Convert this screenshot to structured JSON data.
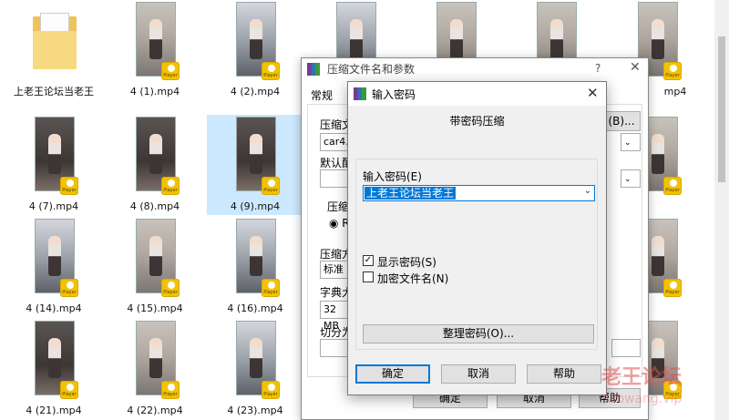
{
  "explorer": {
    "folder_label": "上老王论坛当老王",
    "files": [
      {
        "name": "4 (1).mp4"
      },
      {
        "name": "4 (2).mp4"
      },
      {
        "name": ""
      },
      {
        "name": ""
      },
      {
        "name": ""
      },
      {
        "name": "4"
      },
      {
        "name": "4 (7).mp4"
      },
      {
        "name": "4 (8).mp4"
      },
      {
        "name": "4 (9).mp4"
      },
      {
        "name": "4 (14).mp4"
      },
      {
        "name": "4 (15).mp4"
      },
      {
        "name": "4 (16).mp4"
      },
      {
        "name": "4 (21).mp4"
      },
      {
        "name": "4 (22).mp4"
      },
      {
        "name": "4 (23).mp4"
      }
    ],
    "right_col": [
      "mp4"
    ],
    "badge_label": "Player"
  },
  "back_dialog": {
    "title": "压缩文件名和参数",
    "help_glyph": "?",
    "close_glyph": "✕",
    "tab_general": "常规",
    "labels": [
      "压缩文",
      "默认配",
      "压缩",
      "压缩方",
      "字典大",
      "切分为"
    ],
    "archive_name": "car4.ra",
    "browse_btn": "(B)...",
    "rar_option": "RA",
    "method": "标准",
    "dict_size": "32 MB",
    "ok": "确定",
    "cancel": "取消",
    "help": "帮助"
  },
  "front_dialog": {
    "title": "输入密码",
    "close_glyph": "✕",
    "heading": "带密码压缩",
    "password_label": "输入密码(E)",
    "password_value": "上老王论坛当老王",
    "show_password": "显示密码(S)",
    "encrypt_names": "加密文件名(N)",
    "organize_btn": "整理密码(O)...",
    "ok": "确定",
    "cancel": "取消",
    "help": "帮助"
  },
  "watermark": {
    "line1": "老王论坛",
    "line2": "laowang.vip"
  }
}
